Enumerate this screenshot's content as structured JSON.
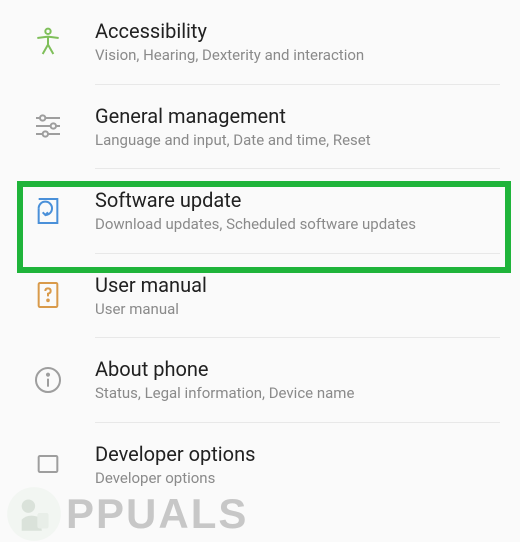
{
  "settings": {
    "items": [
      {
        "title": "Accessibility",
        "subtitle": "Vision, Hearing, Dexterity and interaction",
        "icon": "accessibility-icon",
        "iconColor": "#7fbf5a"
      },
      {
        "title": "General management",
        "subtitle": "Language and input, Date and time, Reset",
        "icon": "sliders-icon",
        "iconColor": "#9e9e9e"
      },
      {
        "title": "Software update",
        "subtitle": "Download updates, Scheduled software updates",
        "icon": "update-icon",
        "iconColor": "#4a90d9",
        "highlighted": true
      },
      {
        "title": "User manual",
        "subtitle": "User manual",
        "icon": "manual-icon",
        "iconColor": "#d99a4a"
      },
      {
        "title": "About phone",
        "subtitle": "Status, Legal information, Device name",
        "icon": "info-icon",
        "iconColor": "#9e9e9e"
      },
      {
        "title": "Developer options",
        "subtitle": "Developer options",
        "icon": "developer-icon",
        "iconColor": "#9e9e9e"
      }
    ]
  },
  "highlight": {
    "color": "#1fb43a"
  },
  "watermark": {
    "text": "PPUALS"
  }
}
